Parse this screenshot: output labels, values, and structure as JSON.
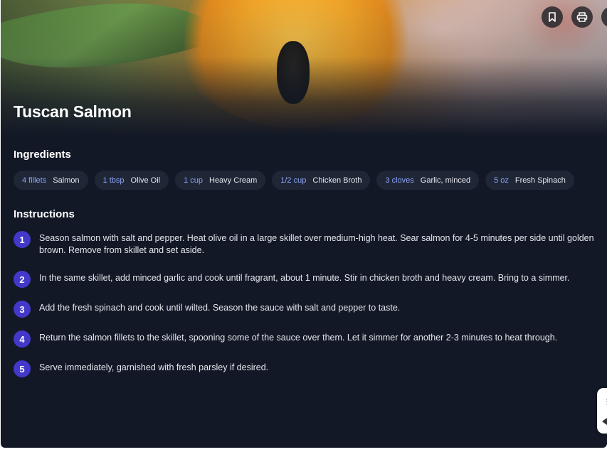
{
  "recipe": {
    "title": "Tuscan Salmon"
  },
  "actions": {
    "bookmark_icon": "bookmark-icon",
    "print_icon": "print-icon"
  },
  "ingredients": {
    "heading": "Ingredients",
    "items": [
      {
        "qty": "4 fillets",
        "name": "Salmon"
      },
      {
        "qty": "1 tbsp",
        "name": "Olive Oil"
      },
      {
        "qty": "1 cup",
        "name": "Heavy Cream"
      },
      {
        "qty": "1/2 cup",
        "name": "Chicken Broth"
      },
      {
        "qty": "3 cloves",
        "name": "Garlic, minced"
      },
      {
        "qty": "5 oz",
        "name": "Fresh Spinach"
      }
    ]
  },
  "instructions": {
    "heading": "Instructions",
    "steps": [
      {
        "number": "1",
        "text": "Season salmon with salt and pepper. Heat olive oil in a large skillet over medium-high heat. Sear salmon for 4-5 minutes per side until golden brown. Remove from skillet and set aside."
      },
      {
        "number": "2",
        "text": "In the same skillet, add minced garlic and cook until fragrant, about 1 minute. Stir in chicken broth and heavy cream. Bring to a simmer."
      },
      {
        "number": "3",
        "text": "Add the fresh spinach and cook until wilted. Season the sauce with salt and pepper to taste."
      },
      {
        "number": "4",
        "text": "Return the salmon fillets to the skillet, spooning some of the sauce over them. Let it simmer for another 2-3 minutes to heat through."
      },
      {
        "number": "5",
        "text": "Serve immediately, garnished with fresh parsley if desired."
      }
    ]
  },
  "colors": {
    "background": "#121826",
    "chip_background": "#1f2636",
    "quantity_accent": "#8da2f8",
    "step_badge": "#4338ca"
  }
}
